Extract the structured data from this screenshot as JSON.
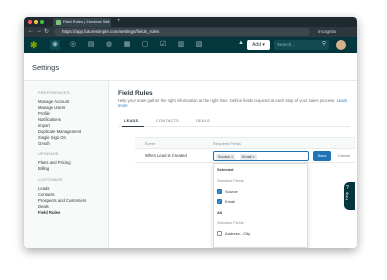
{
  "browser": {
    "tab_title": "Field Rules | Zendesk Sell",
    "tab_close": "×",
    "new_tab": "+",
    "url": "https://app.futuresimple.com/settings/fields_rules",
    "incognito_label": "Incognito",
    "nav_back": "←",
    "nav_forward": "→",
    "nav_reload": "↻",
    "traffic_colors": [
      "#fc605b",
      "#fdbc40",
      "#34c84a"
    ]
  },
  "appbar": {
    "logo": "✱",
    "icons": [
      "◉",
      "◎",
      "▤",
      "◍",
      "▦",
      "▢",
      "☑",
      "▥",
      "▧"
    ],
    "add_label": "Add ▾",
    "search_placeholder": "Search...",
    "search_icon": "⚲",
    "bell": "▲"
  },
  "page": {
    "title": "Settings"
  },
  "sidebar": {
    "sections": [
      {
        "heading": "PREFERENCES",
        "items": [
          "Manage Account",
          "Manage Users",
          "Profile",
          "Notifications",
          "Import",
          "Duplicate Management",
          "Single Sign On",
          "OAuth"
        ]
      },
      {
        "heading": "UPGRADE",
        "items": [
          "Plans and Pricing",
          "Billing"
        ]
      },
      {
        "heading": "CUSTOMIZE",
        "items": [
          "Leads",
          "Contacts",
          "Prospects and Customers",
          "Deals",
          "Field Rules"
        ]
      }
    ],
    "active_item": "Field Rules"
  },
  "content": {
    "title": "Field Rules",
    "description": "Help your team gather the right information at the right time. Define fields required at each step of your sales process.",
    "learn_more": "Learn more",
    "tabs": [
      "LEADS",
      "CONTACTS",
      "DEALS"
    ],
    "active_tab": "LEADS",
    "table": {
      "headers": [
        "Event",
        "Required Fields"
      ],
      "row_event": "When Lead is Created",
      "pills": [
        "Source ×",
        "Email ×"
      ],
      "save_label": "Save",
      "cancel_label": "Cancel"
    },
    "dropdown": {
      "selected_heading": "Selected",
      "standard_heading": "Standard Fields",
      "selected_options": [
        {
          "label": "Source",
          "checked": true
        },
        {
          "label": "Email",
          "checked": true
        }
      ],
      "all_heading": "All",
      "all_standard_heading": "Standard Fields",
      "all_options": [
        {
          "label": "Address - City",
          "checked": false
        }
      ]
    }
  },
  "help": {
    "icon": "?",
    "label": "Help"
  }
}
